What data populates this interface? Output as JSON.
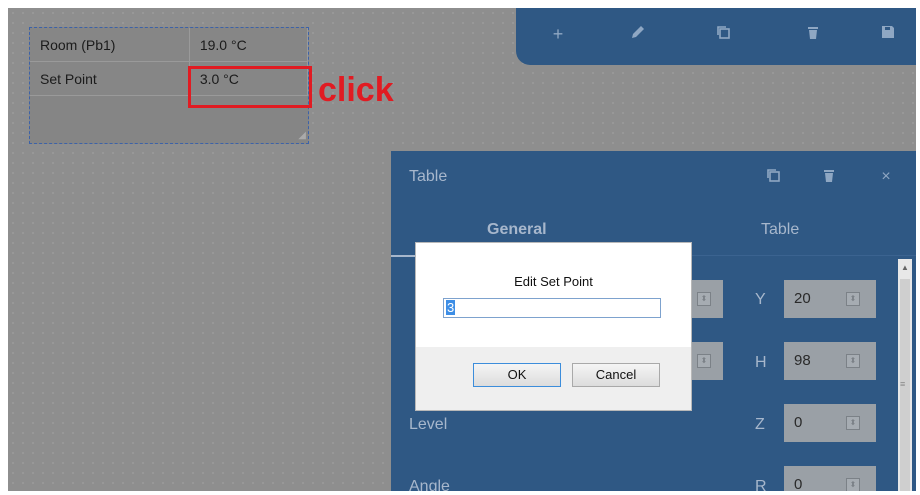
{
  "widget": {
    "rows": [
      {
        "label": "Room (Pb1)",
        "value": "19.0 °C"
      },
      {
        "label": "Set Point",
        "value": "3.0 °C"
      }
    ]
  },
  "annotation": {
    "text": "click",
    "color": "#e11b22"
  },
  "toolbar": {
    "icons": [
      "plus-icon",
      "pencil-icon",
      "copy-icon",
      "trash-icon",
      "save-icon"
    ],
    "plus_glyph": "+"
  },
  "panel": {
    "title": "Table",
    "tabs": [
      "General",
      "Table"
    ],
    "close_glyph": "×",
    "props": {
      "y_label": "Y",
      "y_value": "20",
      "h_label": "H",
      "h_value": "98",
      "z_label": "Z",
      "z_value": "0",
      "r_label": "R",
      "r_value": "0",
      "level_label": "Level",
      "angle_label": "Angle"
    }
  },
  "dialog": {
    "prompt": "Edit Set Point",
    "input_value": "3",
    "ok_label": "OK",
    "cancel_label": "Cancel"
  },
  "colors": {
    "panel_bg": "#2f5884",
    "accent_red": "#e11b22"
  }
}
